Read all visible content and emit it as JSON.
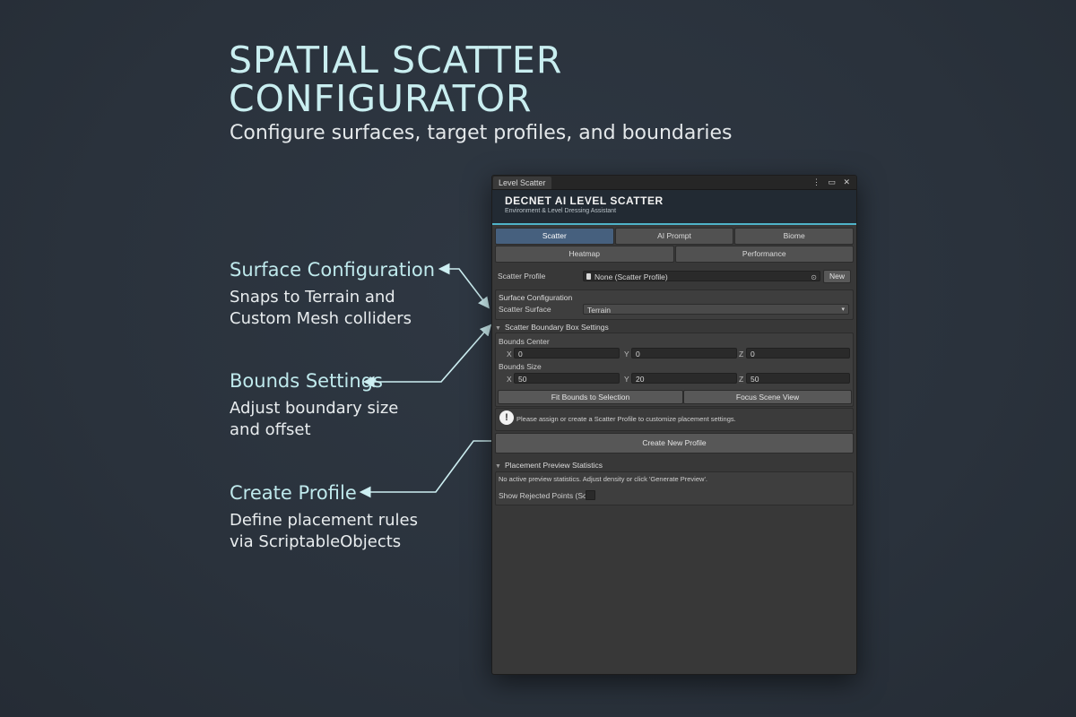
{
  "hero": {
    "title_line1": "SPATIAL SCATTER",
    "title_line2": "CONFIGURATOR",
    "subtitle": "Configure surfaces, target profiles, and boundaries"
  },
  "callouts": [
    {
      "title": "Surface Configuration",
      "desc": "Snaps to Terrain and\nCustom Mesh colliders"
    },
    {
      "title": "Bounds Settings",
      "desc": "Adjust boundary size\nand offset"
    },
    {
      "title": "Create Profile",
      "desc": "Define placement rules\nvia ScriptableObjects"
    }
  ],
  "window": {
    "tab_title": "Level Scatter",
    "controls": "⋮ ▭ ✕",
    "banner_title": "DECNET AI LEVEL SCATTER",
    "banner_subtitle": "Environment & Level Dressing Assistant",
    "tabs_row1": [
      "Scatter",
      "AI Prompt",
      "Biome"
    ],
    "tabs_row2": [
      "Heatmap",
      "Performance"
    ],
    "active_tab": "Scatter",
    "profile": {
      "label": "Scatter Profile",
      "value": "None (Scatter Profile)",
      "new_button": "New"
    },
    "surface": {
      "heading": "Surface Configuration",
      "label": "Scatter Surface",
      "value": "Terrain"
    },
    "bounds": {
      "heading": "Scatter Boundary Box Settings",
      "center_label": "Bounds Center",
      "center": {
        "x": "0",
        "y": "0",
        "z": "0"
      },
      "size_label": "Bounds Size",
      "size": {
        "x": "50",
        "y": "20",
        "z": "50"
      },
      "fit_button": "Fit Bounds to Selection",
      "focus_button": "Focus Scene View"
    },
    "warning": "Please assign or create a Scatter Profile to customize placement settings.",
    "create_button": "Create New Profile",
    "stats": {
      "heading": "Placement Preview Statistics",
      "message": "No active preview statistics. Adjust density or click 'Generate Preview'.",
      "toggle_label": "Show Rejected Points (Sc"
    }
  },
  "axes": {
    "x": "X",
    "y": "Y",
    "z": "Z"
  },
  "colors": {
    "accent": "#4fb3c9",
    "callout_title": "#bfe9ec",
    "active_tab": "#46607e"
  }
}
